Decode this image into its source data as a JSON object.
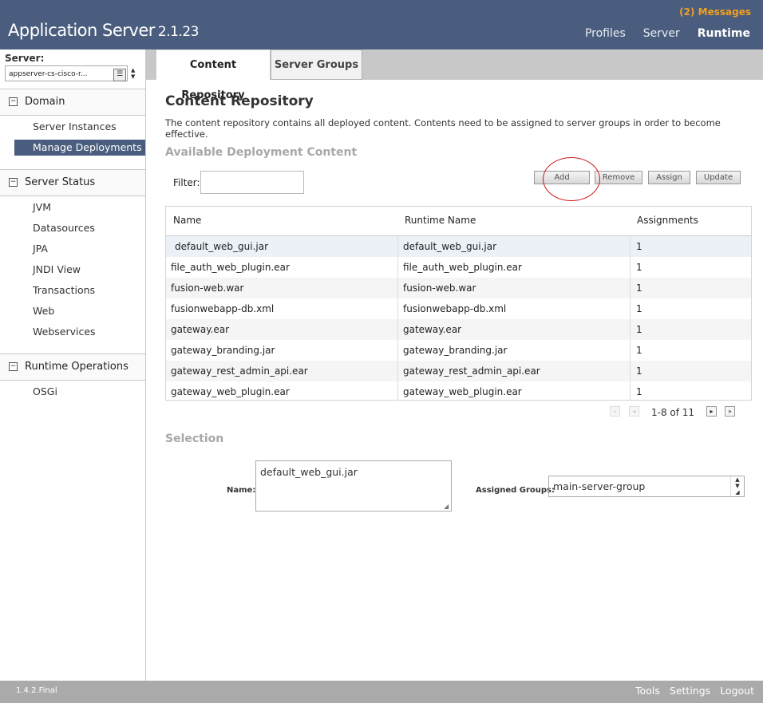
{
  "header": {
    "app_name": "Application Server",
    "version": "2.1.23",
    "messages": "(2) Messages",
    "nav": [
      "Profiles",
      "Server",
      "Runtime"
    ]
  },
  "sidebar": {
    "server_label": "Server:",
    "server_value": "appserver-cs-cisco-r...",
    "sections": [
      {
        "label": "Domain",
        "items": [
          "Server Instances",
          "Manage Deployments"
        ]
      },
      {
        "label": "Server Status",
        "items": [
          "JVM",
          "Datasources",
          "JPA",
          "JNDI View",
          "Transactions",
          "Web",
          "Webservices"
        ]
      },
      {
        "label": "Runtime Operations",
        "items": [
          "OSGi"
        ]
      }
    ],
    "toggle_symbol": "−",
    "selected_item": "Manage Deployments"
  },
  "tabs": [
    "Content Repository",
    "Server Groups"
  ],
  "main": {
    "title": "Content Repository",
    "description": "The content repository contains all deployed content. Contents need to be assigned to server groups in order to become effective.",
    "available_title": "Available Deployment Content",
    "filter_label": "Filter:",
    "filter_value": "",
    "buttons": {
      "add": "Add",
      "remove": "Remove",
      "assign": "Assign",
      "update": "Update"
    },
    "table": {
      "headers": [
        "Name",
        "Runtime Name",
        "Assignments"
      ],
      "rows": [
        [
          "default_web_gui.jar",
          "default_web_gui.jar",
          "1"
        ],
        [
          "file_auth_web_plugin.ear",
          "file_auth_web_plugin.ear",
          "1"
        ],
        [
          "fusion-web.war",
          "fusion-web.war",
          "1"
        ],
        [
          "fusionwebapp-db.xml",
          "fusionwebapp-db.xml",
          "1"
        ],
        [
          "gateway.ear",
          "gateway.ear",
          "1"
        ],
        [
          "gateway_branding.jar",
          "gateway_branding.jar",
          "1"
        ],
        [
          "gateway_rest_admin_api.ear",
          "gateway_rest_admin_api.ear",
          "1"
        ],
        [
          "gateway_web_plugin.ear",
          "gateway_web_plugin.ear",
          "1"
        ]
      ]
    },
    "pager": {
      "text": "1-8 of 11",
      "first": "«",
      "prev": "◂",
      "next": "▸",
      "last": "»"
    },
    "selection_title": "Selection",
    "name_label": "Name:",
    "name_value": "default_web_gui.jar",
    "groups_label": "Assigned Groups:",
    "groups_value": "main-server-group"
  },
  "footer": {
    "version": "1.4.2.Final",
    "links": [
      "Tools",
      "Settings",
      "Logout"
    ]
  },
  "colors": {
    "header_bg": "#4a5d7e",
    "selected_nav": "#4a5d7e",
    "messages": "#f0a020",
    "annotation": "#d01818"
  }
}
